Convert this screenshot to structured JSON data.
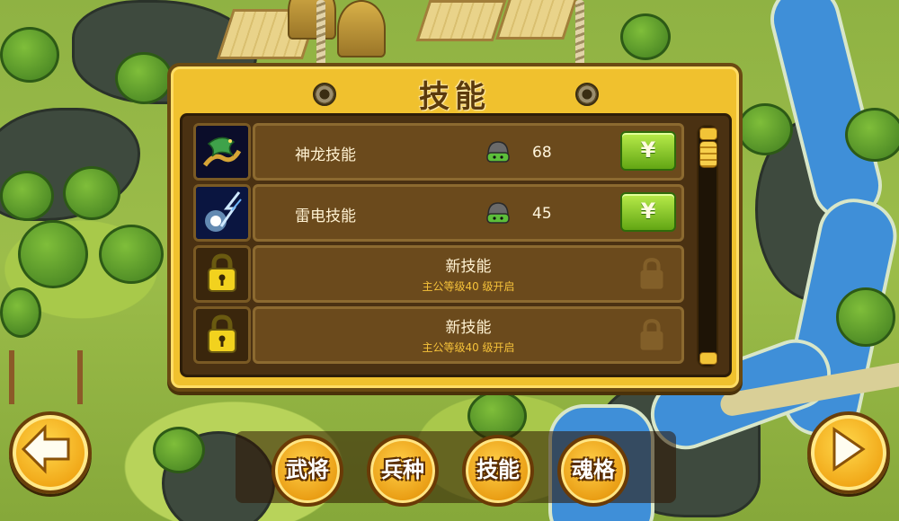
{
  "panel": {
    "title": "技能"
  },
  "skills": [
    {
      "name": "神龙技能",
      "cost": "68",
      "buy_label": "¥",
      "icon": "dragon-icon"
    },
    {
      "name": "雷电技能",
      "cost": "45",
      "buy_label": "¥",
      "icon": "lightning-icon"
    }
  ],
  "locked_skills": [
    {
      "name": "新技能",
      "requirement": "主公等级40 级开启"
    },
    {
      "name": "新技能",
      "requirement": "主公等级40 级开启"
    }
  ],
  "nav": {
    "back_icon": "arrow-left-icon",
    "next_icon": "play-right-icon"
  },
  "tabs": [
    {
      "label": "武将"
    },
    {
      "label": "兵种"
    },
    {
      "label": "技能"
    },
    {
      "label": "魂格"
    }
  ],
  "colors": {
    "panel_gold": "#f0c12e",
    "buy_green": "#7fc820",
    "unlock_text": "#f5c23a"
  }
}
